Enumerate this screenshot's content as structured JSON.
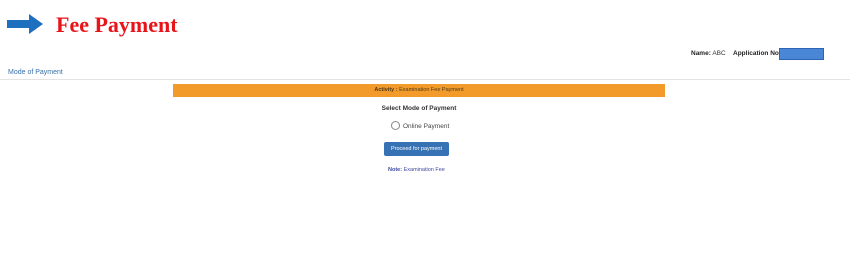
{
  "header": {
    "title": "Fee Payment",
    "arrow_icon": "right-arrow-icon",
    "arrow_color": "#1f6fbf",
    "title_color": "#e8141a"
  },
  "applicant": {
    "name_label": "Name:",
    "name_value": "ABC",
    "application_label": "Application No:"
  },
  "section": {
    "title": "Mode of Payment"
  },
  "activity": {
    "label": "Activity :",
    "value": "Examination Fee Payment",
    "bar_color": "#f39b2a"
  },
  "payment": {
    "heading": "Select Mode of Payment",
    "option_label": "Online Payment",
    "proceed_label": "Proceed for payment",
    "button_color": "#3773b4"
  },
  "note": {
    "label": "Note:",
    "value": "Examination Fee"
  }
}
